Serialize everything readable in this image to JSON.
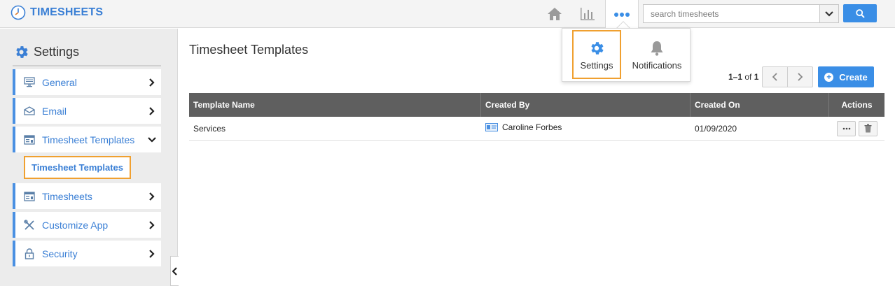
{
  "app": {
    "title": "TIMESHEETS",
    "logo_icon": "clock-icon"
  },
  "topnav": {
    "home_icon": "home-icon",
    "reports_icon": "bar-chart-icon",
    "more_icon": "more-dots-icon",
    "search_placeholder": "search timesheets",
    "accent_color": "#3a8ee6"
  },
  "dropdown": {
    "items": [
      {
        "label": "Settings",
        "icon": "gear-icon",
        "highlighted": true
      },
      {
        "label": "Notifications",
        "icon": "bell-icon"
      }
    ]
  },
  "sidebar": {
    "header": "Settings",
    "items": [
      {
        "label": "General",
        "icon": "monitor-icon",
        "expanded": false
      },
      {
        "label": "Email",
        "icon": "envelope-icon",
        "expanded": false
      },
      {
        "label": "Timesheet Templates",
        "icon": "template-icon",
        "expanded": true
      },
      {
        "label": "Timesheets",
        "icon": "timesheet-icon",
        "expanded": false
      },
      {
        "label": "Customize App",
        "icon": "tools-icon",
        "expanded": false
      },
      {
        "label": "Security",
        "icon": "lock-icon",
        "expanded": false
      }
    ],
    "sub_item": "Timesheet Templates"
  },
  "main": {
    "title": "Timesheet Templates",
    "pager": {
      "range": "1–1",
      "of": "of",
      "total": "1"
    },
    "create_label": "Create",
    "columns": [
      "Template Name",
      "Created By",
      "Created On",
      "Actions"
    ],
    "rows": [
      {
        "name": "Services",
        "created_by": "Caroline Forbes",
        "created_on": "01/09/2020"
      }
    ]
  }
}
